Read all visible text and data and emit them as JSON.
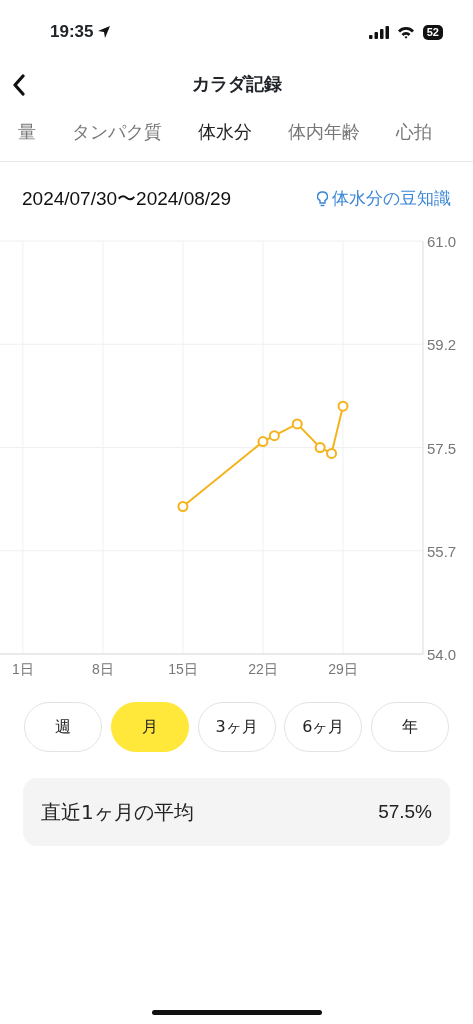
{
  "status_bar": {
    "time": "19:35",
    "battery": "52"
  },
  "header": {
    "title": "カラダ記録"
  },
  "tabs": [
    {
      "label": "量",
      "selected": false
    },
    {
      "label": "タンパク質",
      "selected": false
    },
    {
      "label": "体水分",
      "selected": true
    },
    {
      "label": "体内年齢",
      "selected": false
    },
    {
      "label": "心拍",
      "selected": false
    }
  ],
  "range": {
    "dates": "2024/07/30〜2024/08/29",
    "tip_link": "体水分の豆知識"
  },
  "chart_data": {
    "type": "line",
    "x": [
      15,
      22,
      23,
      25,
      27,
      28,
      29
    ],
    "grid": true,
    "series": [
      {
        "color": "#f5b31b",
        "marker": "circle",
        "values": [
          56.5,
          57.6,
          57.7,
          57.9,
          57.5,
          57.4,
          58.2
        ]
      }
    ],
    "xlim": [
      -1,
      36
    ],
    "ylim": [
      54.0,
      61.0
    ],
    "xticks": [
      {
        "value": 1,
        "label": "1日"
      },
      {
        "value": 8,
        "label": "8日"
      },
      {
        "value": 15,
        "label": "15日"
      },
      {
        "value": 22,
        "label": "22日"
      },
      {
        "value": 29,
        "label": "29日"
      }
    ],
    "yticks": [
      {
        "value": 61.0,
        "label": "61.0"
      },
      {
        "value": 59.25,
        "label": "59.2"
      },
      {
        "value": 57.5,
        "label": "57.5"
      },
      {
        "value": 55.75,
        "label": "55.7"
      },
      {
        "value": 54.0,
        "label": "54.0"
      }
    ]
  },
  "periods": [
    {
      "label": "週",
      "selected": false
    },
    {
      "label": "月",
      "selected": true
    },
    {
      "label": "3ヶ月",
      "selected": false
    },
    {
      "label": "6ヶ月",
      "selected": false
    },
    {
      "label": "年",
      "selected": false
    }
  ],
  "summary": {
    "label": "直近1ヶ月の平均",
    "value": "57.5%"
  }
}
